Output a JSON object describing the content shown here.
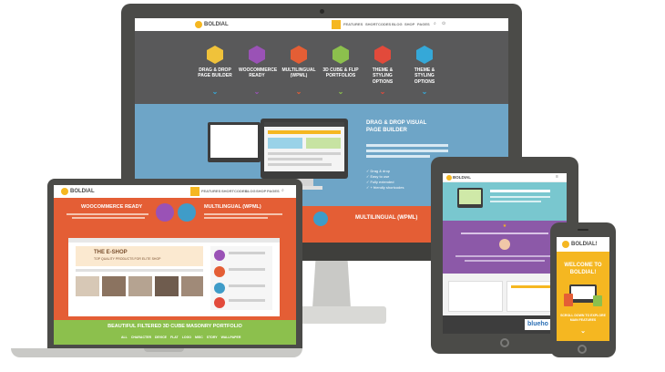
{
  "brand": {
    "name": "BOLDIAL",
    "phone_name": "BOLDIAL!",
    "accent": "#f5b721"
  },
  "nav": {
    "items": [
      "FEATURES",
      "SHORTCODES",
      "BLOG",
      "SHOP",
      "PAGES"
    ]
  },
  "imac": {
    "features": [
      {
        "label": "DRAG & DROP PAGE BUILDER",
        "color": "#f0c23a",
        "chevron": "#35a8d8"
      },
      {
        "label": "WOOCOMMERCE READY",
        "color": "#9a52b6",
        "chevron": "#9a52b6"
      },
      {
        "label": "MULTILINGUAL (WPML)",
        "color": "#e45e35",
        "chevron": "#e45e35"
      },
      {
        "label": "3D CUBE & FLIP PORTFOLIOS",
        "color": "#8cc04d",
        "chevron": "#8cc04d"
      },
      {
        "label": "THEME & STYLING OPTIONS",
        "color": "#e24a3b",
        "chevron": "#e24a3b"
      },
      {
        "label": "THEME & STYLING OPTIONS",
        "color": "#35a8d8",
        "chevron": "#35a8d8"
      }
    ],
    "hero_title": "DRAG & DROP VISUAL PAGE BUILDER",
    "checklist": [
      "Drag & drop",
      "Easy to use",
      "Fully extended",
      "+ friendly shortcodes"
    ]
  },
  "laptop": {
    "col_left_title": "WOOCOMMERCE READY",
    "col_right_title": "MULTILINGUAL (WPML)",
    "shop_title": "THE E-SHOP",
    "shop_subtitle": "TOP QUALITY PRODUCTS FOR ELITE SHOP",
    "band_title": "BEAUTIFUL FILTERED 3D CUBE MASONRY PORTFOLIO",
    "filters": [
      "ALL",
      "CHARACTER",
      "DEVICE",
      "FLAT",
      "LOGO",
      "MISC",
      "STORY",
      "WALLPAPER"
    ]
  },
  "imac_peek": {
    "multilingual": "MULTILINGUAL (WPML)"
  },
  "tablet": {
    "host_logo": "blueho"
  },
  "phone": {
    "welcome": "WELCOME TO BOLDIAL!",
    "scroll_text": "SCROLL DOWN TO EXPLORE MAIN FEATURES"
  }
}
